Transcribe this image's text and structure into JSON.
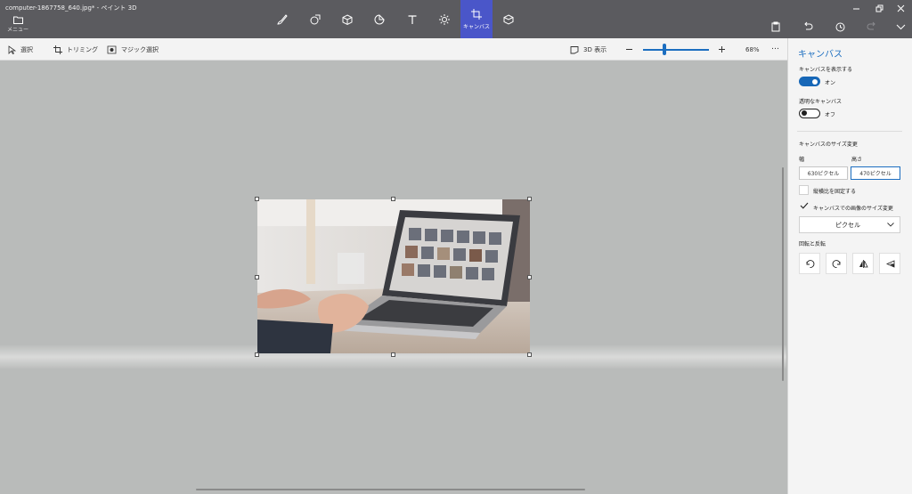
{
  "window": {
    "title": "computer-1867758_640.jpg* - ペイント 3D"
  },
  "ribbon": {
    "menu_label": "メニュー",
    "tools": [
      {
        "icon": "brush-icon",
        "label": ""
      },
      {
        "icon": "2d-shapes-icon",
        "label": ""
      },
      {
        "icon": "3d-shapes-icon",
        "label": ""
      },
      {
        "icon": "stickers-icon",
        "label": ""
      },
      {
        "icon": "text-icon",
        "label": ""
      },
      {
        "icon": "effects-icon",
        "label": ""
      },
      {
        "icon": "canvas-icon",
        "label": "キャンバス",
        "active": true
      },
      {
        "icon": "3d-library-icon",
        "label": ""
      }
    ],
    "right_tools": [
      "paste-icon",
      "undo-icon",
      "history-icon",
      "redo-icon",
      "chevron-down-icon"
    ]
  },
  "toolbar": {
    "select_label": "選択",
    "trim_label": "トリミング",
    "magic_select_label": "マジック選択",
    "view3d_label": "3D 表示",
    "zoom_level": "68%",
    "zoom_fraction": 0.3,
    "more_label": "…"
  },
  "panel": {
    "title": "キャンバス",
    "show_canvas_label": "キャンバスを表示する",
    "show_canvas_state": "オン",
    "transparent_label": "透明なキャンバス",
    "transparent_state": "オフ",
    "resize_heading": "キャンバスのサイズ変更",
    "width_label": "幅",
    "height_label": "高さ",
    "width_value": "630ピクセル",
    "height_value": "470ピクセル",
    "lock_aspect_label": "縦横比を固定する",
    "lock_aspect_checked": false,
    "resize_image_label": "キャンバスでの画像のサイズ変更",
    "resize_image_checked": true,
    "unit_value": "ピクセル",
    "rotate_heading": "回転と反転"
  },
  "colors": {
    "accent": "#1c6ec0",
    "ribbon": "#5b5b5f",
    "active_tool": "#4a56c9",
    "canvas_bg": "#b9bbba"
  }
}
